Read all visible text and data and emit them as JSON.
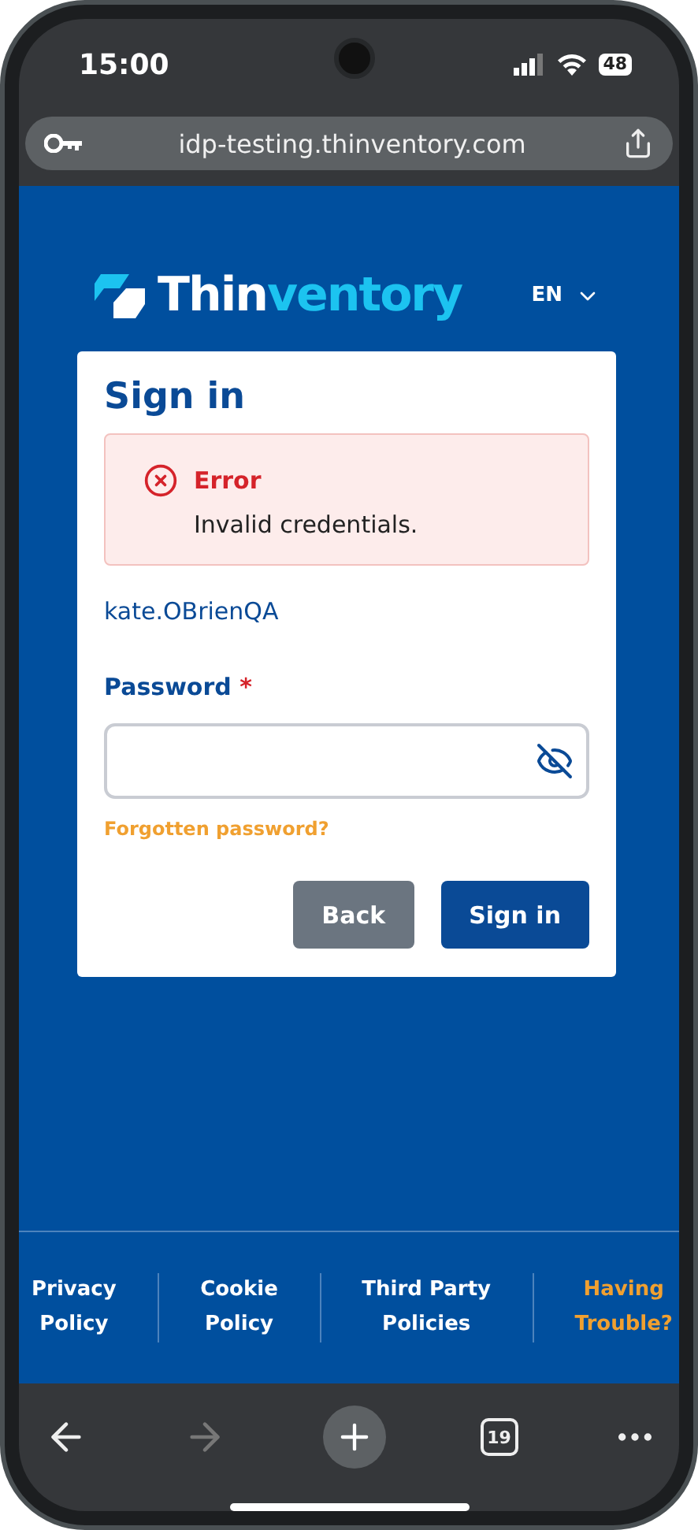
{
  "status_bar": {
    "time": "15:00",
    "battery": "48"
  },
  "browser": {
    "url": "idp-testing.thinventory.com",
    "tab_count": "19",
    "forward_disabled": true
  },
  "header": {
    "logo": {
      "first": "Thin",
      "second": "ventory"
    },
    "language": "EN"
  },
  "card": {
    "title": "Sign in",
    "error": {
      "title": "Error",
      "message": "Invalid credentials."
    },
    "username": "kate.OBrienQA",
    "password": {
      "label": "Password",
      "required_mark": "*"
    },
    "forgot_link": "Forgotten password?",
    "buttons": [
      {
        "label": "Back",
        "kind": "secondary"
      },
      {
        "label": "Sign in",
        "kind": "primary"
      }
    ]
  },
  "footer_links": [
    {
      "lines": [
        "Privacy",
        "Policy"
      ],
      "highlighted": false
    },
    {
      "lines": [
        "Cookie",
        "Policy"
      ],
      "highlighted": false
    },
    {
      "lines": [
        "Third Party",
        "Policies"
      ],
      "highlighted": false
    },
    {
      "lines": [
        "Having",
        "Trouble?"
      ],
      "highlighted": true
    }
  ]
}
